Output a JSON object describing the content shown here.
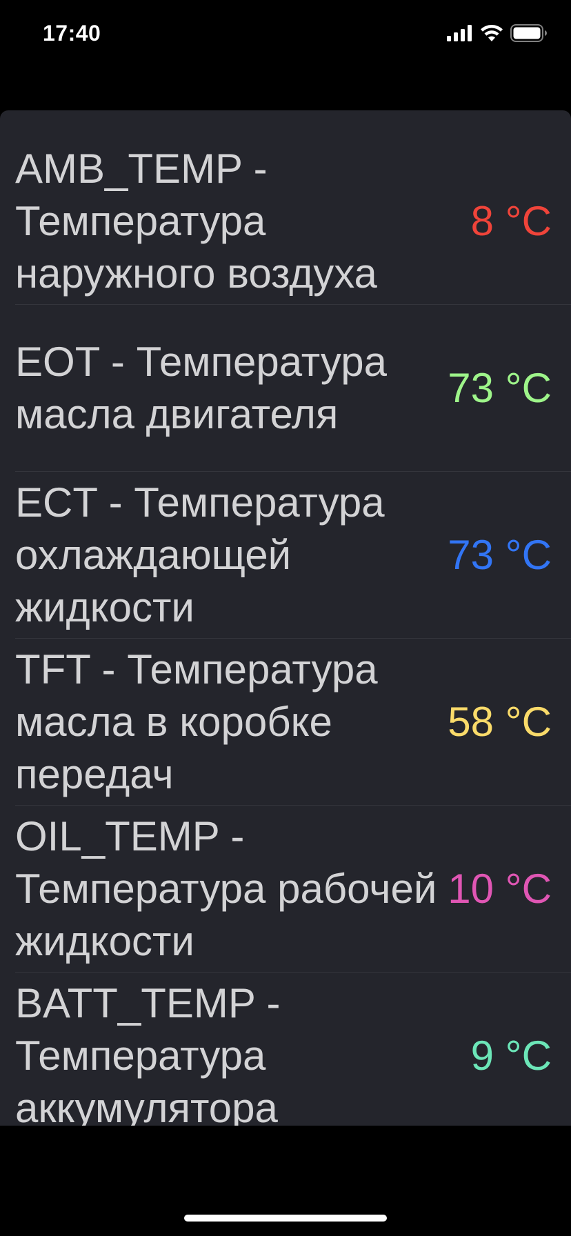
{
  "status_bar": {
    "time": "17:40",
    "icons": [
      "cellular-signal-icon",
      "wifi-icon",
      "battery-icon"
    ]
  },
  "sensors": [
    {
      "label": "AMB_TEMP - Температура наружного воздуха",
      "value": "8 °C",
      "color": "#f0443a"
    },
    {
      "label": "EOT - Температура масла двигателя",
      "value": "73 °C",
      "color": "#9ef58a"
    },
    {
      "label": "ECT - Температура охлаждающей жидкости",
      "value": "73 °C",
      "color": "#3275f5"
    },
    {
      "label": "TFT - Температура масла в коробке передач",
      "value": "58 °C",
      "color": "#fadb6a"
    },
    {
      "label": "OIL_TEMP - Температура рабочей жидкости",
      "value": "10 °C",
      "color": "#e056b4"
    },
    {
      "label": "BATT_TEMP - Температура аккумулятора",
      "value": "9 °C",
      "color": "#6ce6b8"
    }
  ]
}
